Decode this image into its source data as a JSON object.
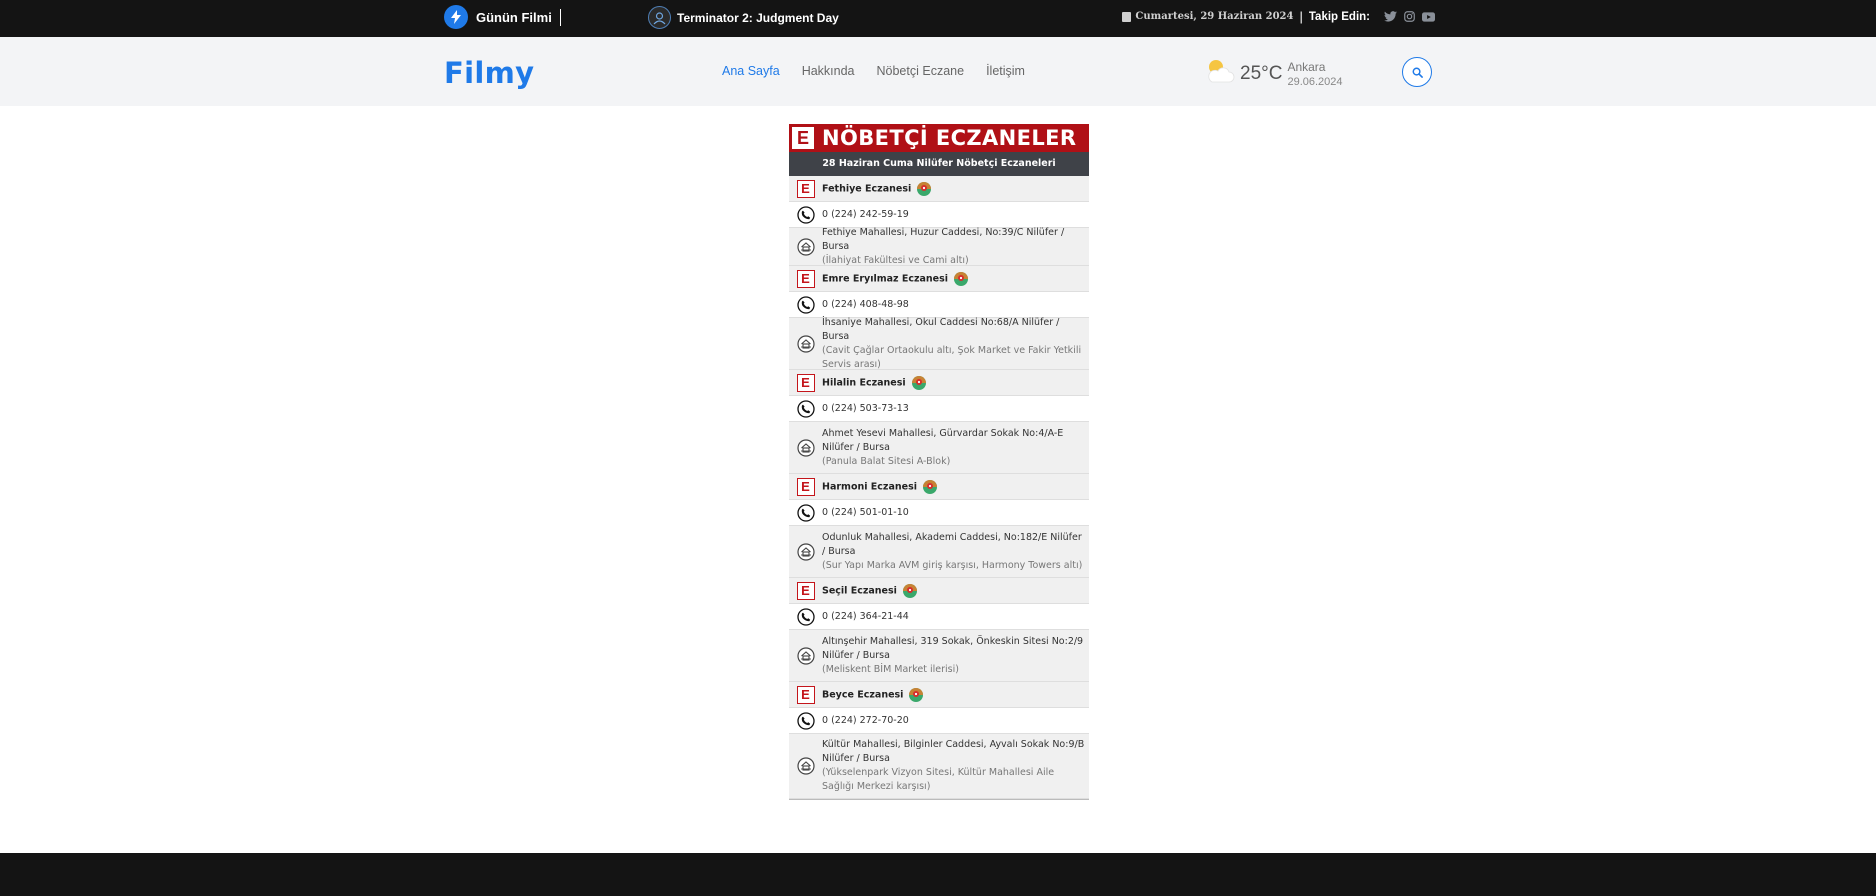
{
  "topbar": {
    "featured_label": "Günün Filmi",
    "movie_title": "Terminator 2: Judgment Day",
    "date": "Cumartesi, 29 Haziran 2024",
    "follow_label": "Takip Edin:",
    "separator": "|"
  },
  "nav": {
    "logo": "Filmy",
    "items": [
      {
        "label": "Ana Sayfa"
      },
      {
        "label": "Hakkında"
      },
      {
        "label": "Nöbetçi Eczane"
      },
      {
        "label": "İletişim"
      }
    ],
    "active_item": "Ana Sayfa"
  },
  "weather": {
    "temperature": "25°C",
    "city": "Ankara",
    "date": "29.06.2024",
    "icon": "partly-cloudy-icon"
  },
  "pharmacy": {
    "banner_badge": "E",
    "banner_title": "NÖBETÇİ ECZANELER",
    "subtitle": "28 Haziran Cuma Nilüfer Nöbetçi Eczaneleri",
    "entries": [
      {
        "name": "Fethiye Eczanesi",
        "phone": "0 (224) 242-59-19",
        "address": "Fethiye Mahallesi, Huzur Caddesi, No:39/C Nilüfer / Bursa",
        "note": "(İlahiyat Fakültesi ve Cami altı)"
      },
      {
        "name": "Emre Eryılmaz Eczanesi",
        "phone": "0 (224) 408-48-98",
        "address": "İhsaniye Mahallesi, Okul Caddesi No:68/A Nilüfer / Bursa",
        "note": "(Cavit Çağlar Ortaokulu altı, Şok Market ve Fakir Yetkili Servis arası)"
      },
      {
        "name": "Hilalin Eczanesi",
        "phone": "0 (224) 503-73-13",
        "address": "Ahmet Yesevi Mahallesi, Gürvardar Sokak No:4/A-E Nilüfer / Bursa",
        "note": "(Panula Balat Sitesi A-Blok)"
      },
      {
        "name": "Harmoni Eczanesi",
        "phone": "0 (224) 501-01-10",
        "address": "Odunluk Mahallesi, Akademi Caddesi, No:182/E Nilüfer / Bursa",
        "note": "(Sur Yapı Marka AVM giriş karşısı, Harmony Towers altı)"
      },
      {
        "name": "Seçil Eczanesi",
        "phone": "0 (224) 364-21-44",
        "address": "Altınşehir Mahallesi, 319 Sokak, Önkeskin Sitesi No:2/9 Nilüfer / Bursa",
        "note": "(Meliskent BİM Market ilerisi)"
      },
      {
        "name": "Beyce Eczanesi",
        "phone": "0 (224) 272-70-20",
        "address": "Kültür Mahallesi, Bilginler Caddesi, Ayvalı Sokak No:9/B Nilüfer / Bursa",
        "note": "(Yükselenpark Vizyon Sitesi, Kültür Mahallesi Aile Sağlığı Merkezi karşısı)"
      }
    ]
  },
  "colors": {
    "accent": "#1f7ae8",
    "topbar_bg": "#141414",
    "navbar_bg": "#f3f4f6",
    "banner_red": "#b01016",
    "subtitle_bg": "#3f4248"
  }
}
